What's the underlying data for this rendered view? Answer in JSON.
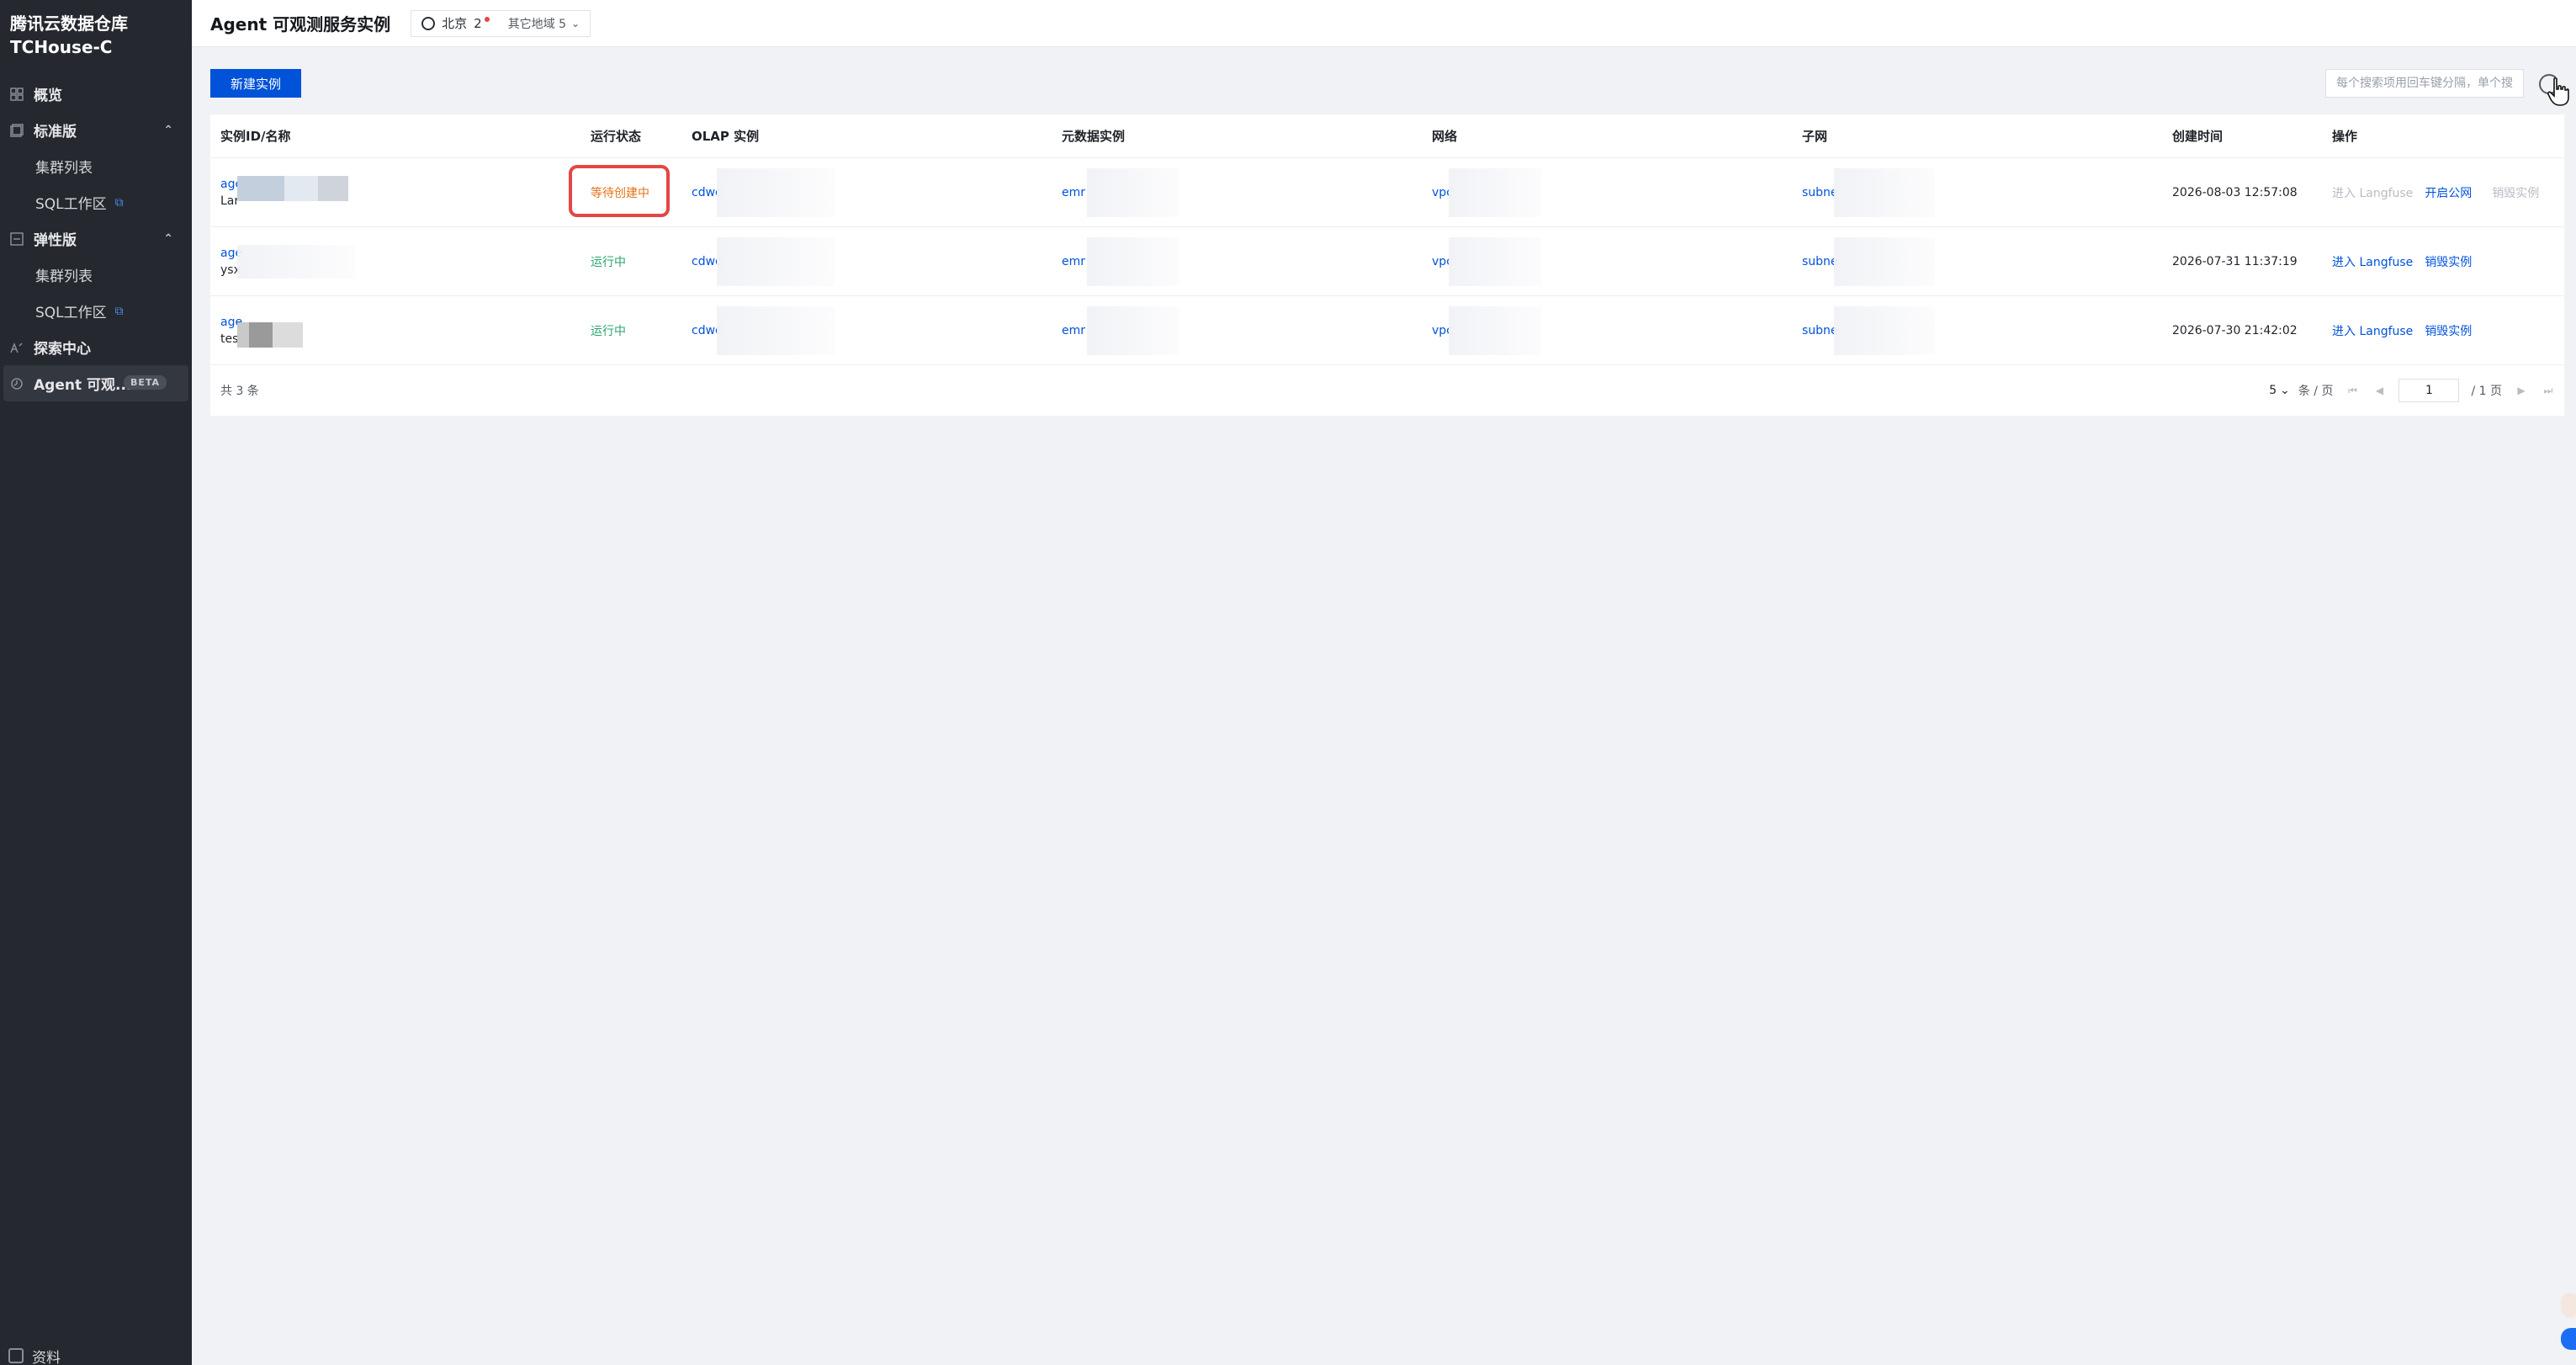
{
  "sidebar": {
    "brand_line1": "腾讯云数据仓库",
    "brand_line2": "TCHouse-C",
    "items": [
      {
        "label": "概览"
      },
      {
        "label": "标准版"
      },
      {
        "label": "集群列表"
      },
      {
        "label": "SQL工作区"
      },
      {
        "label": "弹性版"
      },
      {
        "label": "集群列表"
      },
      {
        "label": "SQL工作区"
      },
      {
        "label": "探索中心"
      },
      {
        "label": "Agent 可观..."
      }
    ],
    "beta": "BETA",
    "bottom_label": "资料"
  },
  "header": {
    "title": "Agent 可观测服务实例",
    "region": "北京",
    "region_count": "2",
    "others": "其它地域 5"
  },
  "toolbar": {
    "create_label": "新建实例",
    "search_placeholder": "每个搜索项用回车键分隔，单个搜"
  },
  "table": {
    "columns": [
      "实例ID/名称",
      "运行状态",
      "OLAP 实例",
      "元数据实例",
      "网络",
      "子网",
      "创建时间",
      "操作"
    ],
    "rows": [
      {
        "id": "age",
        "name": "Lar",
        "status": "等待创建中",
        "olap": "cdwc",
        "meta": "emr",
        "vpc": "vpc",
        "subnet": "subne",
        "created": "2026-08-03 12:57:08",
        "op1": "进入 Langfuse",
        "op2": "开启公网",
        "op3": "销毁实例"
      },
      {
        "id": "age",
        "name": "ysx",
        "status": "运行中",
        "olap": "cdwc",
        "meta": "emr",
        "vpc": "vpc",
        "subnet": "subne",
        "created": "2026-07-31 11:37:19",
        "op1": "进入 Langfuse",
        "op2": "销毁实例"
      },
      {
        "id": "age",
        "name": "tes",
        "status": "运行中",
        "olap": "cdwc",
        "meta": "emr",
        "vpc": "vpc",
        "subnet": "subne",
        "created": "2026-07-30 21:42:02",
        "op1": "进入 Langfuse",
        "op2": "销毁实例"
      }
    ]
  },
  "footer": {
    "total": "共 3 条",
    "page_size": "5",
    "page_size_unit": "条 / 页",
    "current_page": "1",
    "total_pages": "/ 1 页"
  },
  "colors": {
    "primary": "#0052d9",
    "waiting": "#e37318",
    "running": "#2ba471",
    "highlight": "#e54545",
    "sidebar_bg": "#25282e"
  },
  "icons": [
    "overview-icon",
    "standard-icon",
    "elastic-icon",
    "explore-icon",
    "agent-icon",
    "globe-icon",
    "refresh-icon",
    "external-link-icon"
  ]
}
